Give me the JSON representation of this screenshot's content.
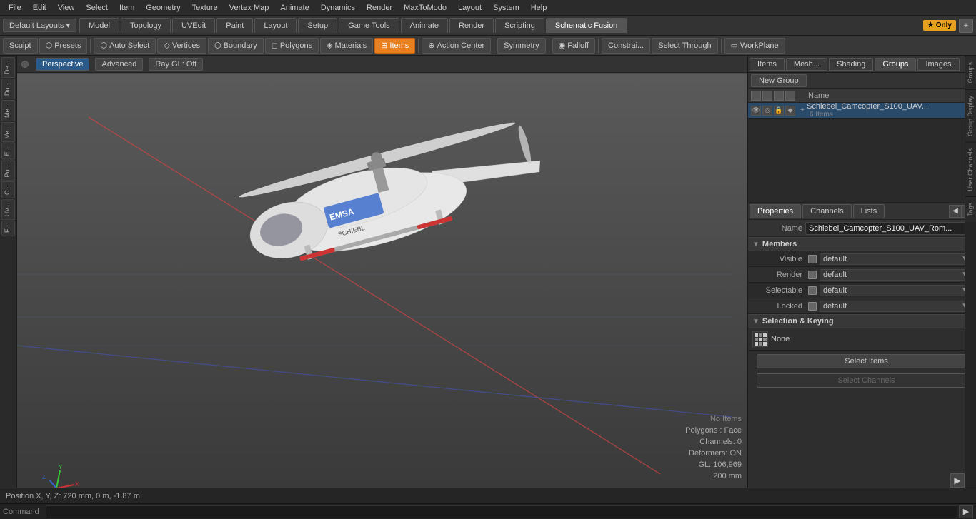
{
  "menu": {
    "items": [
      "File",
      "Edit",
      "View",
      "Select",
      "Item",
      "Geometry",
      "Texture",
      "Vertex Map",
      "Animate",
      "Dynamics",
      "Render",
      "MaxToModo",
      "Layout",
      "System",
      "Help"
    ]
  },
  "layout": {
    "dropdown": "Default Layouts ▾",
    "tabs": [
      "Model",
      "Topology",
      "UVEdit",
      "Paint",
      "Layout",
      "Setup",
      "Game Tools",
      "Animate",
      "Render",
      "Scripting",
      "Schematic Fusion"
    ],
    "active_tab": "Schematic Fusion",
    "star_label": "★ Only",
    "plus_label": "+"
  },
  "toolbar": {
    "sculpt": "Sculpt",
    "presets": "Presets",
    "auto_select": "Auto Select",
    "vertices": "Vertices",
    "boundary": "Boundary",
    "polygons": "Polygons",
    "materials": "Materials",
    "items": "Items",
    "action_center": "Action Center",
    "symmetry": "Symmetry",
    "falloff": "Falloff",
    "constrai": "Constrai...",
    "select_through": "Select Through",
    "workplane": "WorkPlane"
  },
  "viewport": {
    "tabs": [
      "Perspective",
      "Advanced",
      "Ray GL: Off"
    ],
    "active_tab": "Perspective",
    "info": {
      "no_items": "No Items",
      "polygons": "Polygons : Face",
      "channels": "Channels: 0",
      "deformers": "Deformers: ON",
      "gl": "GL: 106,969",
      "size": "200 mm"
    }
  },
  "left_sidebar": {
    "items": [
      "De...",
      "Du...",
      "Me...",
      "Ve...",
      "E...",
      "Po...",
      "C...",
      "UV...",
      "F..."
    ]
  },
  "right_panel": {
    "groups_tabs": [
      "Items",
      "Mesh...",
      "Shading",
      "Groups",
      "Images"
    ],
    "active_groups_tab": "Groups",
    "new_group_label": "New Group",
    "list_header": "Name",
    "group_item": {
      "name": "Schiebel_Camcopter_S100_UAV...",
      "count": "6 Items",
      "plus": "+"
    },
    "properties": {
      "tabs": [
        "Properties",
        "Channels",
        "Lists"
      ],
      "active_tab": "Properties",
      "name_label": "Name",
      "name_value": "Schiebel_Camcopter_S100_UAV_Rom...",
      "members_label": "Members",
      "visible_label": "Visible",
      "visible_value": "default",
      "render_label": "Render",
      "render_value": "default",
      "selectable_label": "Selectable",
      "selectable_value": "default",
      "locked_label": "Locked",
      "locked_value": "default",
      "selection_keying_label": "Selection & Keying",
      "keying_value": "None",
      "select_items_label": "Select Items",
      "select_channels_label": "Select Channels"
    }
  },
  "status_bar": {
    "position": "Position X, Y, Z:  720 mm, 0 m, -1.87 m"
  },
  "command_bar": {
    "label": "Command",
    "placeholder": "",
    "run_btn": "▶"
  },
  "edge_tabs": [
    "Groups",
    "Group Display",
    "User Channels",
    "Tags"
  ]
}
